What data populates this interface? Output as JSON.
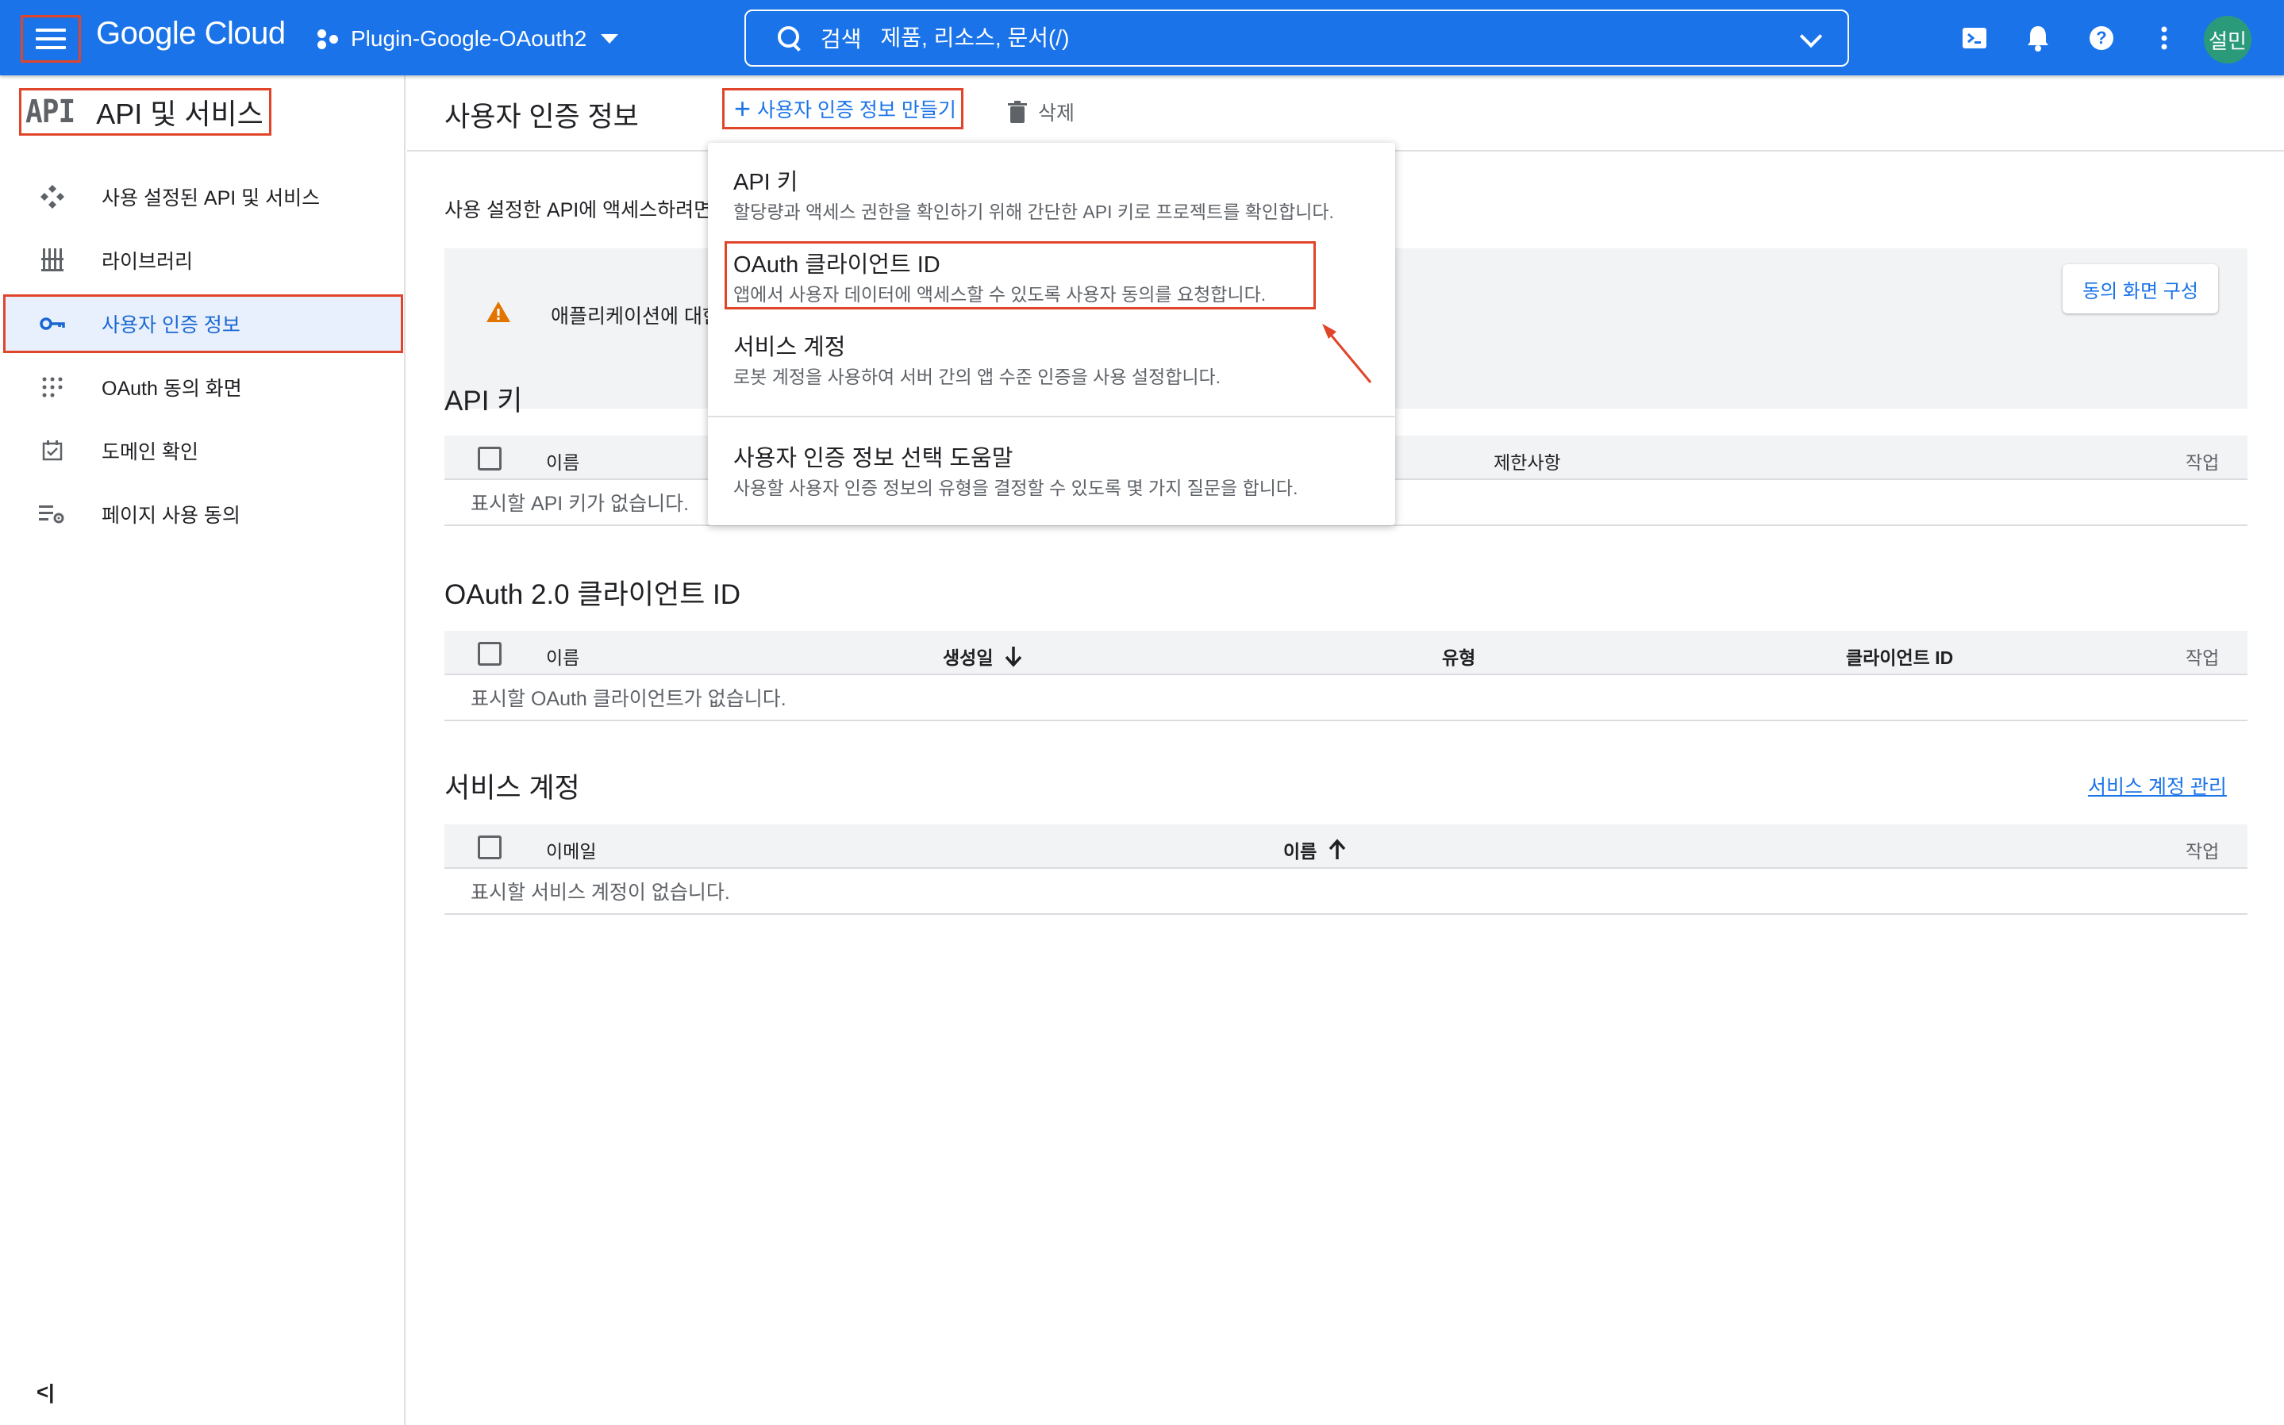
{
  "topbar": {
    "logo": "Google Cloud",
    "project": "Plugin-Google-OAouth2",
    "search_label": "검색",
    "search_placeholder": "제품, 리소스, 문서(/)",
    "avatar": "설민"
  },
  "sidebar": {
    "logo_text": "API",
    "title": "API 및 서비스",
    "items": [
      {
        "label": "사용 설정된 API 및 서비스",
        "icon": "api-diamond-icon"
      },
      {
        "label": "라이브러리",
        "icon": "library-icon"
      },
      {
        "label": "사용자 인증 정보",
        "icon": "key-icon",
        "active": true
      },
      {
        "label": "OAuth 동의 화면",
        "icon": "dots-grid-icon"
      },
      {
        "label": "도메인 확인",
        "icon": "checkbox-icon"
      },
      {
        "label": "페이지 사용 동의",
        "icon": "list-settings-icon"
      }
    ],
    "collapse": "<|"
  },
  "page": {
    "title": "사용자 인증 정보",
    "create_label": "사용자 인증 정보 만들기",
    "delete_label": "삭제",
    "intro": "사용 설정한 API에 액세스하려면",
    "banner_text": "애플리케이션에 대한",
    "consent_button": "동의 화면 구성"
  },
  "dropdown": {
    "items": [
      {
        "title": "API 키",
        "desc": "할당량과 액세스 권한을 확인하기 위해 간단한 API 키로 프로젝트를 확인합니다."
      },
      {
        "title": "OAuth 클라이언트 ID",
        "desc": "앱에서 사용자 데이터에 액세스할 수 있도록 사용자 동의를 요청합니다."
      },
      {
        "title": "서비스 계정",
        "desc": "로봇 계정을 사용하여 서버 간의 앱 수준 인증을 사용 설정합니다."
      },
      {
        "title": "사용자 인증 정보 선택 도움말",
        "desc": "사용할 사용자 인증 정보의 유형을 결정할 수 있도록 몇 가지 질문을 합니다."
      }
    ]
  },
  "api_keys": {
    "title": "API 키",
    "columns": {
      "name": "이름",
      "restrictions": "제한사항",
      "actions": "작업"
    },
    "empty": "표시할 API 키가 없습니다."
  },
  "oauth": {
    "title": "OAuth 2.0 클라이언트 ID",
    "columns": {
      "name": "이름",
      "created": "생성일",
      "type": "유형",
      "client_id": "클라이언트 ID",
      "actions": "작업"
    },
    "empty": "표시할 OAuth 클라이언트가 없습니다."
  },
  "service_accounts": {
    "title": "서비스 계정",
    "manage_link": "서비스 계정 관리",
    "columns": {
      "email": "이메일",
      "name": "이름",
      "actions": "작업"
    },
    "empty": "표시할 서비스 계정이 없습니다."
  },
  "colors": {
    "brand": "#1a73e8",
    "highlight": "#e0452a",
    "active_bg": "#e8f0fe",
    "avatar": "#2b9a7a"
  }
}
